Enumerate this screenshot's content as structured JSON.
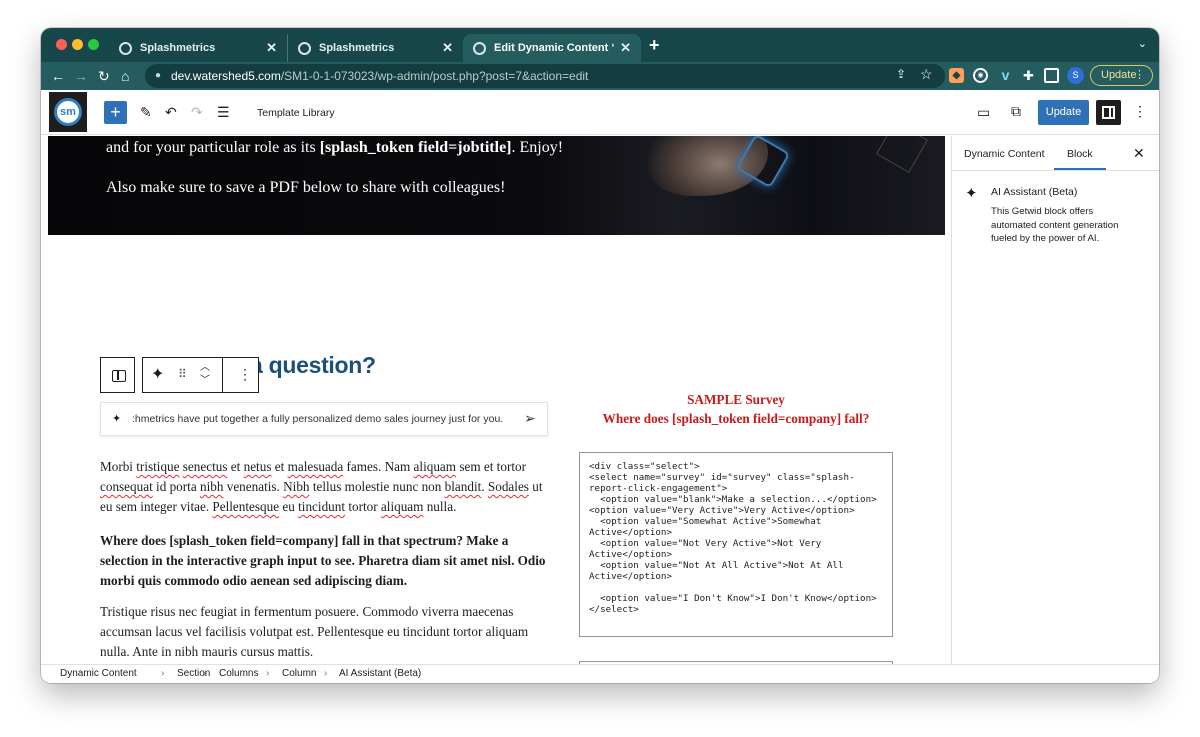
{
  "browser": {
    "tabs": [
      {
        "title": "Splashmetrics"
      },
      {
        "title": "Splashmetrics"
      },
      {
        "title": "Edit Dynamic Content “Version"
      }
    ],
    "url_host": "dev.watershed5.com",
    "url_path": "/SM1-0-1-073023/wp-admin/post.php?post=7&action=edit",
    "update_label": "Update",
    "profile_initial": "S"
  },
  "editor": {
    "logo_text": "sm",
    "template_library": "Template Library",
    "update_button": "Update"
  },
  "hero": {
    "line1_pre": "and for your particular role as its ",
    "line1_token": "[splash_token field=jobtitle]",
    "line1_post": ". Enjoy!",
    "line2": "Also make sure to save a PDF below to share with colleagues!"
  },
  "content": {
    "heading_fragment": "a question?",
    "ai_prompt": ":hmetrics have put together a fully personalized demo sales journey just for you.",
    "para1_words": [
      "Morbi ",
      "tristique",
      " ",
      "senectus",
      " et ",
      "netus",
      " et ",
      "malesuada",
      " fames. Nam ",
      "aliquam",
      " sem et tortor ",
      "consequat",
      " id porta ",
      "nibh",
      " venenatis. ",
      "Nibh",
      " tellus molestie nunc non ",
      "blandit",
      ". ",
      "Sodales",
      " ut eu sem integer vitae. ",
      "Pellentesque",
      " eu ",
      "tincidunt",
      " tortor ",
      "aliquam",
      " nulla."
    ],
    "para2": "Where does [splash_token field=company] fall in that spectrum? Make a selection in the interactive graph input to see. Pharetra diam sit amet nisl. Odio morbi quis commodo odio aenean sed adipiscing diam.",
    "para3": "Tristique risus nec feugiat in fermentum posuere. Commodo viverra maecenas accumsan lacus vel facilisis volutpat est. Pellentesque eu tincidunt tortor aliquam nulla. Ante in nibh mauris cursus mattis.",
    "survey_title_1": "SAMPLE Survey",
    "survey_title_2": "Where does [splash_token field=company] fall?",
    "code": "<div class=\"select\">\n<select name=\"survey\" id=\"survey\" class=\"splash-report-click-engagement\">\n  <option value=\"blank\">Make a selection...</option>\n<option value=\"Very Active\">Very Active</option>\n  <option value=\"Somewhat Active\">Somewhat Active</option>\n  <option value=\"Not Very Active\">Not Very Active</option>\n  <option value=\"Not At All Active\">Not At All Active</option>\n\n  <option value=\"I Don't Know\">I Don't Know</option>\n</select>"
  },
  "sidebar": {
    "tab_dynamic": "Dynamic Content",
    "tab_block": "Block",
    "block_title": "AI Assistant (Beta)",
    "block_desc": "This Getwid block offers automated content generation fueled by the power of AI."
  },
  "breadcrumb": [
    "Dynamic Content",
    "Section",
    "Columns",
    "Column",
    "AI Assistant (Beta)"
  ],
  "colors": {
    "chrome": "#17474a",
    "accent": "#2f71b6",
    "heading": "#1d4f7d",
    "survey_red": "#c71a1a"
  }
}
